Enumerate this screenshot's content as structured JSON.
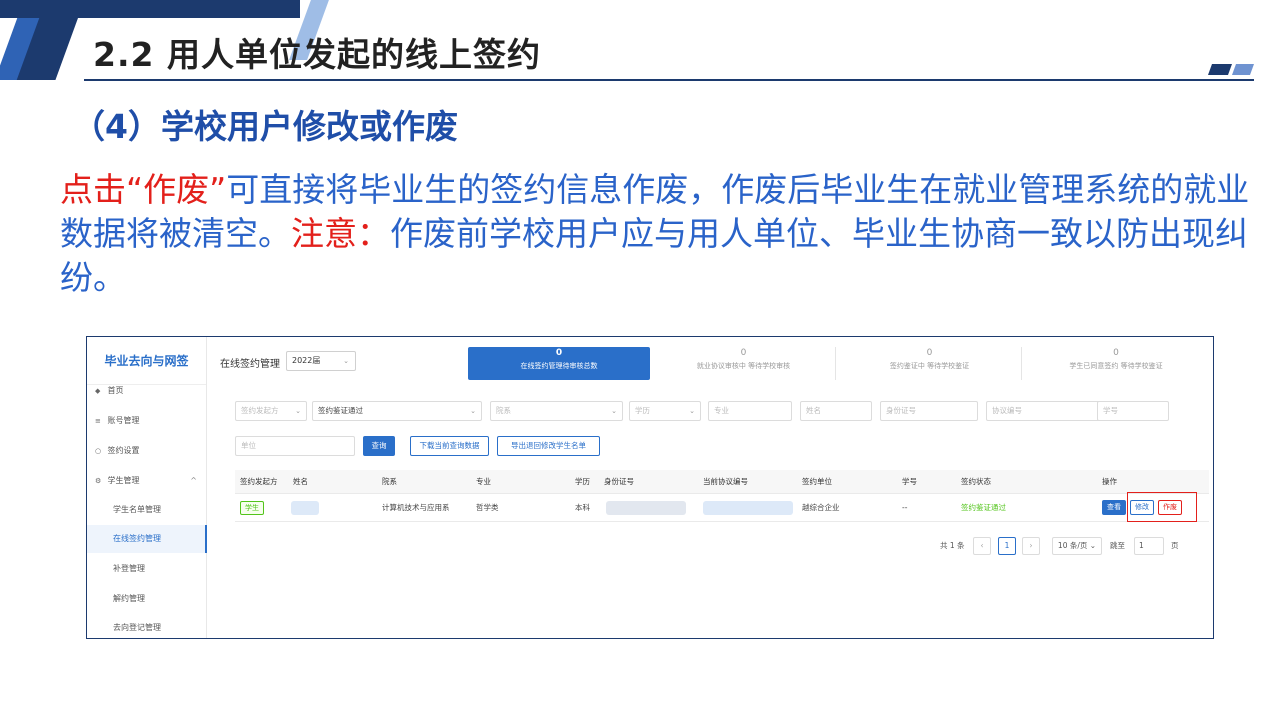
{
  "slide": {
    "title": "2.2 用人单位发起的线上签约",
    "subtitle": "（4）学校用户修改或作废",
    "para_red1": "点击“作废”",
    "para_blue1": "可直接将毕业生的签约信息作废，作废后毕业生在就业管理系统的就业数据将被清空。",
    "para_red2": "注意：",
    "para_blue2": "作废前学校用户应与用人单位、毕业生协商一致以防出现纠纷。"
  },
  "app": {
    "logo": "毕业去向与网签",
    "page_title": "在线签约管理",
    "year": "2022届",
    "nav": [
      {
        "label": "首页",
        "icon": "◆"
      },
      {
        "label": "账号管理",
        "icon": "≡"
      },
      {
        "label": "签约设置",
        "icon": "○"
      },
      {
        "label": "学生管理",
        "icon": "⚙",
        "caret": "^"
      },
      {
        "label": "学生名单管理"
      },
      {
        "label": "在线签约管理"
      },
      {
        "label": "补登管理"
      },
      {
        "label": "解约管理"
      },
      {
        "label": "去向登记管理"
      }
    ],
    "stats": [
      {
        "num": "0",
        "label": "在线签约管理待审核总数"
      },
      {
        "num": "0",
        "label": "就业协议审核中 等待学校审核"
      },
      {
        "num": "0",
        "label": "签约鉴证中 等待学校鉴证"
      },
      {
        "num": "0",
        "label": "学生已同意签约 等待学校鉴证"
      }
    ],
    "filters": {
      "initiator": "签约发起方",
      "status": "签约鉴证通过",
      "department": "院系",
      "education": "学历",
      "major": "专业",
      "name": "姓名",
      "id_number": "身份证号",
      "agreement_no": "协议编号",
      "student_no": "学号",
      "unit": "单位"
    },
    "buttons": {
      "query": "查询",
      "download": "下载当前查询数据",
      "export": "导出退回修改学生名单"
    },
    "table": {
      "headers": [
        "签约发起方",
        "姓名",
        "院系",
        "专业",
        "学历",
        "身份证号",
        "当前协议编号",
        "签约单位",
        "学号",
        "签约状态",
        "操作"
      ],
      "row": {
        "initiator": "学生",
        "department": "计算机技术与应用系",
        "major": "哲学类",
        "education": "本科",
        "unit": "越综合企业",
        "student_no": "--",
        "status": "签约鉴证通过",
        "op_view": "查看",
        "op_edit": "修改",
        "op_void": "作废"
      }
    },
    "pager": {
      "total": "共 1 条",
      "prev": "‹",
      "page": "1",
      "next": "›",
      "size": "10 条/页",
      "jump": "跳至",
      "jump_value": "1",
      "unit": "页"
    }
  }
}
